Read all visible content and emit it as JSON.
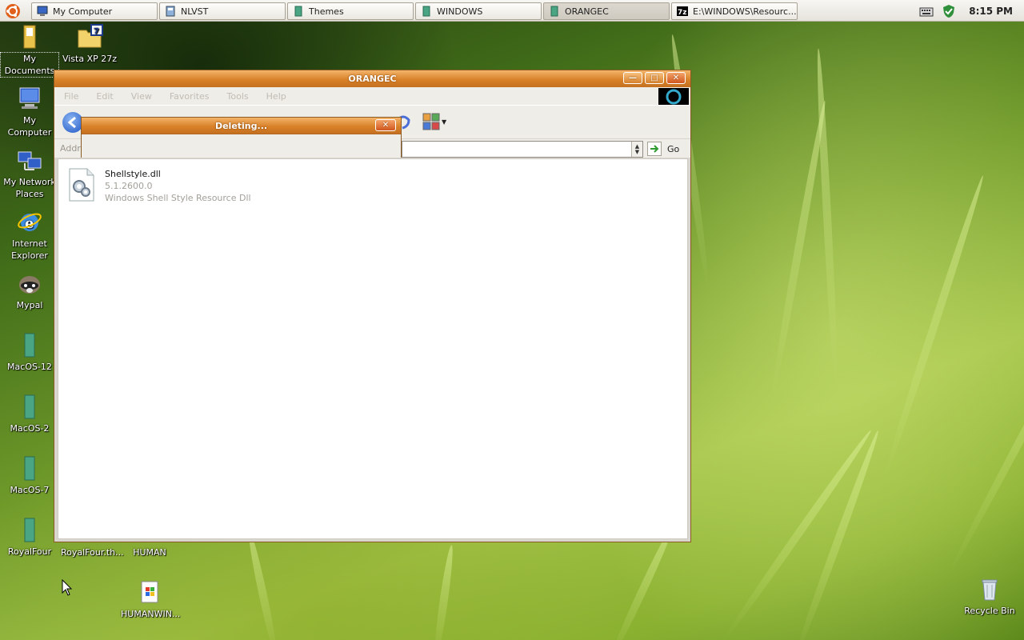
{
  "taskbar": {
    "tasks": [
      {
        "label": "My Computer",
        "icon": "computer-icon",
        "active": false
      },
      {
        "label": "NLVST",
        "icon": "folder-doc-icon",
        "active": false
      },
      {
        "label": "Themes",
        "icon": "folder-icon",
        "active": false
      },
      {
        "label": "WINDOWS",
        "icon": "folder-icon",
        "active": false
      },
      {
        "label": "ORANGEC",
        "icon": "folder-icon",
        "active": true
      },
      {
        "label": "E:\\WINDOWS\\Resourc...",
        "icon": "7zip-icon",
        "active": false
      }
    ],
    "clock": "8:15 PM"
  },
  "desktop": {
    "icons": [
      {
        "label": "My Documents",
        "icon": "documents-folder-icon",
        "selected": true
      },
      {
        "label": "Vista XP 27z",
        "icon": "7z-archive-icon"
      },
      {
        "label": "My Computer",
        "icon": "computer-icon"
      },
      {
        "label": "My Network Places",
        "icon": "network-icon"
      },
      {
        "label": "Internet Explorer",
        "icon": "ie-icon"
      },
      {
        "label": "Mypal",
        "icon": "mypal-icon"
      },
      {
        "label": "MacOS-12",
        "icon": "folder-icon"
      },
      {
        "label": "MacOS-2",
        "icon": "folder-icon"
      },
      {
        "label": "MacOS-7",
        "icon": "folder-icon"
      },
      {
        "label": "RoyalFour",
        "icon": "folder-icon"
      },
      {
        "label": "RoyalFour.th...",
        "icon": "file-icon"
      },
      {
        "label": "HUMAN",
        "icon": "file-icon"
      },
      {
        "label": "HUMANWIN...",
        "icon": "installer-icon"
      },
      {
        "label": "Recycle Bin",
        "icon": "recycle-bin-icon"
      }
    ]
  },
  "window": {
    "title": "ORANGEC",
    "menu": [
      "File",
      "Edit",
      "View",
      "Favorites",
      "Tools",
      "Help"
    ],
    "address_label": "Addre",
    "go_label": "Go",
    "file": {
      "name": "Shellstyle.dll",
      "version": "5.1.2600.0",
      "description": "Windows Shell Style Resource Dll"
    }
  },
  "dialog": {
    "title": "Deleting..."
  },
  "colors": {
    "title_orange": "#d9822a",
    "taskbar_bg": "#ece9e2"
  }
}
